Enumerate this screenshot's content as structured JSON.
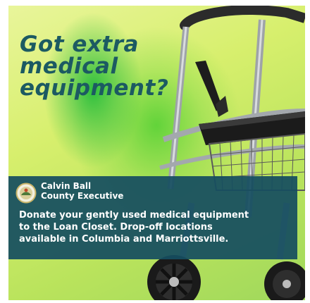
{
  "headline": {
    "line1": "Got extra",
    "line2": "medical",
    "line3": "equipment?"
  },
  "sender": {
    "line1": "Calvin Ball",
    "line2": "County Executive"
  },
  "message": {
    "line1": "Donate your gently used medical  equipment",
    "line2": "to the Loan Closet. Drop-off locations",
    "line3": "available in Columbia and Marriottsville."
  },
  "colors": {
    "headline": "#1c5a62",
    "banner": "#164e60",
    "background_light": "#e9f59b",
    "background_green": "#2fbf3e"
  },
  "icons": {
    "walker": "rollator-walker-photo",
    "seal": "county-seal-icon"
  }
}
